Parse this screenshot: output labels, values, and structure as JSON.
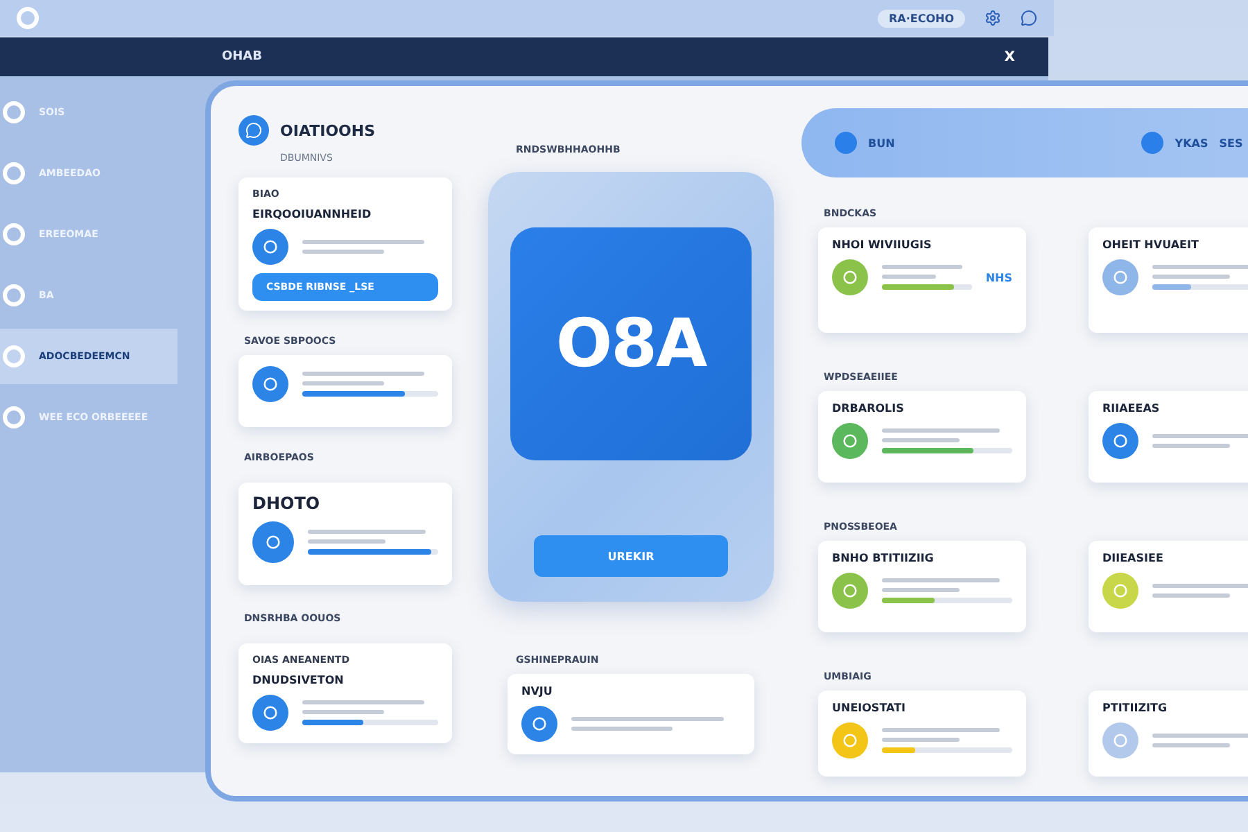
{
  "top_bar": {
    "label": "RA·ECOHO"
  },
  "back_window": {
    "title": "OHAB",
    "close": "X",
    "sidebar": [
      {
        "label": "SOIS",
        "selected": false
      },
      {
        "label": "AMBEEDAO",
        "selected": false
      },
      {
        "label": "EREEOMAE",
        "selected": false
      },
      {
        "label": "BA",
        "selected": false
      },
      {
        "label": "ADOCBEDEEMCN",
        "selected": true
      },
      {
        "label": "WEE ECO ORBEEEEE",
        "selected": false
      }
    ]
  },
  "panel": {
    "title": "OIATIOOHS",
    "subtitle": "DBUMNIVS",
    "left": [
      {
        "card": {
          "tag": "BIAO",
          "title": "EIRQOOIUANNHEID",
          "color": "#2b84e6",
          "button": "CSBDE RIBNSE _LSE"
        }
      },
      {
        "heading": "SAVOE SBPOOCS",
        "card": {
          "color": "#2b84e6",
          "level": 0.75
        }
      },
      {
        "heading": "AIRBOEPAOS",
        "card": {
          "title": "DHOTO",
          "color": "#2b84e6",
          "level": 0.95
        }
      },
      {
        "heading": "DNSRHBA OOUOS",
        "card": {
          "tag": "OIAS ANEANENTD",
          "title": "DNUDSIVETON",
          "color": "#2b84e6",
          "level": 0.45
        }
      }
    ],
    "middle": {
      "heading": "RNDSWBHHAOHHB",
      "logo": "O8A",
      "button": "UREKIR",
      "bottom": {
        "heading": "GSHINEPRAUIN",
        "card": {
          "title": "NVJU",
          "color": "#2b84e6"
        }
      }
    },
    "pill": {
      "left_label": "BUN",
      "right_label": "YKAS",
      "right_value": "SES"
    },
    "right": [
      {
        "heading": "BNDCKAS",
        "cards": [
          {
            "title": "NHOI WIVIIUGIS",
            "color": "#8bc34a",
            "value": "NHS",
            "level": 0.8
          },
          {
            "title": "OHEIT HVUAEIT",
            "color": "#8fb6e8",
            "level": 0.3
          }
        ]
      },
      {
        "heading": "WPDSEAEIIEE",
        "cards": [
          {
            "title": "DRBAROLIS",
            "color": "#5cb85c",
            "level": 0.7
          },
          {
            "title": "RIIAEEAS",
            "color": "#2b84e6"
          }
        ]
      },
      {
        "heading": "PNOSSBEOEA",
        "cards": [
          {
            "title": "BNHO BTITIIZIIG",
            "color": "#8bc34a",
            "level": 0.4
          },
          {
            "title": "DIIEASIEE",
            "color": "#c8d64a"
          }
        ]
      },
      {
        "heading": "UMBIAIG",
        "cards": [
          {
            "title": "UNEIOSTATI",
            "color": "#f2c516",
            "level": 0.25
          },
          {
            "title": "PTITIIZITG",
            "color": "#b3c9ec"
          }
        ]
      }
    ]
  }
}
